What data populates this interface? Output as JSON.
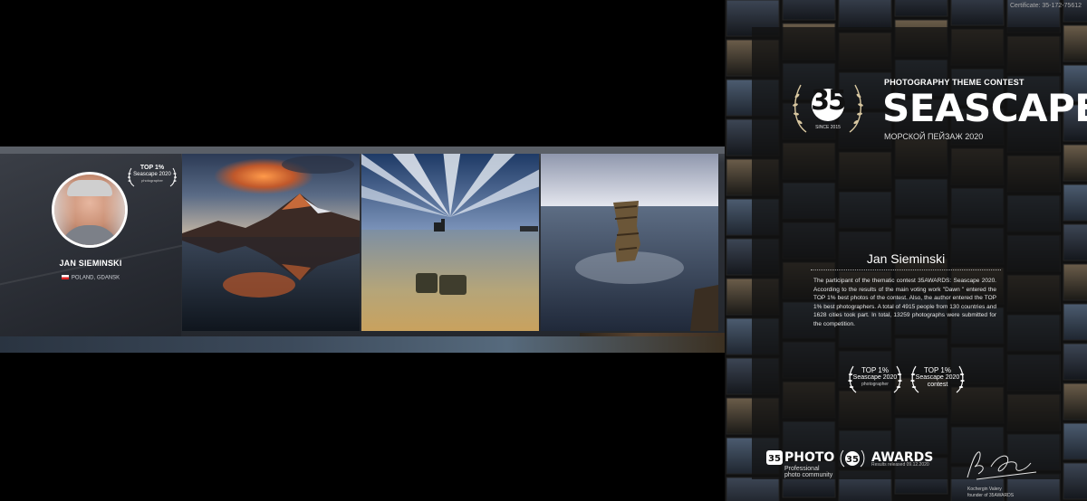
{
  "banner": {
    "badge": {
      "line1": "TOP 1%",
      "line2": "Seascape 2020",
      "line3": "photographer"
    },
    "photographer": {
      "name": "JAN SIEMINSKI",
      "location": "POLAND, GDANSK"
    }
  },
  "certificate": {
    "code": "Certificate: 35-172-75612",
    "logo": {
      "number": "35",
      "since": "SINCE 2015"
    },
    "contest_label": "PHOTOGRAPHY THEME CONTEST",
    "contest_title": "SEASCAPE",
    "contest_subtitle": "МОРСКОЙ ПЕЙЗАЖ 2020",
    "name": "Jan Sieminski",
    "text": "The participant of the thematic contest 35AWARDS: Seascape 2020. According to the results of the main voting work \"Dawn \" entered the TOP 1% best photos of the contest. Also, the author entered the TOP 1% best photographers. A total of 4915 people from 130 countries and 1628 cities took part. In total, 13259 photographs were submitted for the competition.",
    "badges": [
      {
        "line1": "TOP 1%",
        "line2": "Seascape 2020",
        "line3": "photographer"
      },
      {
        "line1": "TOP 1%",
        "line2": "Seascape 2020",
        "line3": "contest"
      }
    ],
    "footer": {
      "photo_label": "PHOTO",
      "photo_sub1": "Professional",
      "photo_sub2": "photo community",
      "awards_label": "AWARDS",
      "awards_sub": "Results released 09.12.2020",
      "signer1": "Kochergin Valery",
      "signer2": "founder of 35AWARDS"
    }
  },
  "colors": {
    "background": "#000000",
    "panel": "#23262c",
    "accent": "#d8c7a0"
  }
}
